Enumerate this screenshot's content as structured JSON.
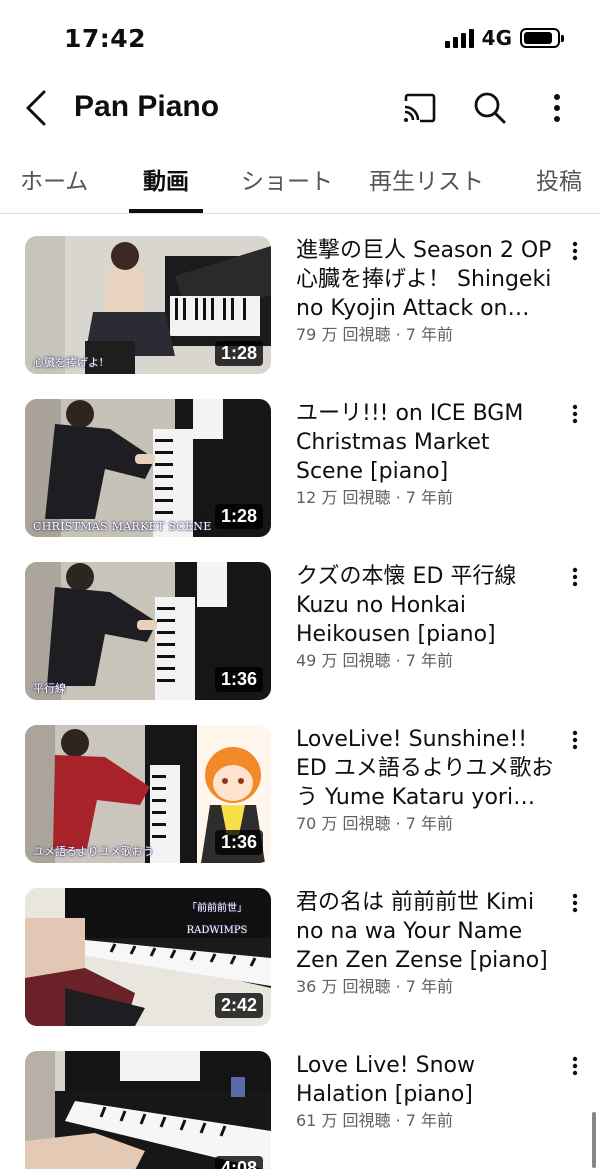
{
  "status": {
    "time": "17:42",
    "network": "4G"
  },
  "header": {
    "channel_name": "Pan Piano"
  },
  "tabs": [
    {
      "label": "ホーム"
    },
    {
      "label": "動画"
    },
    {
      "label": "ショート"
    },
    {
      "label": "再生リスト"
    },
    {
      "label": "投稿"
    }
  ],
  "active_tab": "動画",
  "videos": [
    {
      "title": "進撃の巨人 Season 2 OP 心臓を捧げよ！ Shingeki no Kyojin Attack on Titan",
      "meta": "79 万 回視聴 · 7 年前",
      "duration": "1:28",
      "overlay": "心臓を捧げよ!"
    },
    {
      "title": "ユーリ!!! on ICE BGM Christmas Market Scene [piano]",
      "meta": "12 万 回視聴 · 7 年前",
      "duration": "1:28",
      "overlay": "CHRISTMAS MARKET SCENE"
    },
    {
      "title": "クズの本懐 ED 平行線 Kuzu no Honkai Heikousen [piano]",
      "meta": "49 万 回視聴 · 7 年前",
      "duration": "1:36",
      "overlay": "平行線"
    },
    {
      "title": "LoveLive! Sunshine!! ED ユメ語るよりユメ歌おう  Yume Kataru yori Yume Utaou",
      "meta": "70 万 回視聴 · 7 年前",
      "duration": "1:36",
      "overlay": "ユメ語るよりユメ歌おう"
    },
    {
      "title": "君の名は 前前前世 Kimi no na wa Your Name Zen Zen Zense [piano]",
      "meta": "36 万 回視聴 · 7 年前",
      "duration": "2:42",
      "overlay": "「前前前世」 RADWIMPS"
    },
    {
      "title": "Love Live! Snow Halation [piano]",
      "meta": "61 万 回視聴 · 7 年前",
      "duration": "4:08",
      "overlay": ""
    }
  ]
}
